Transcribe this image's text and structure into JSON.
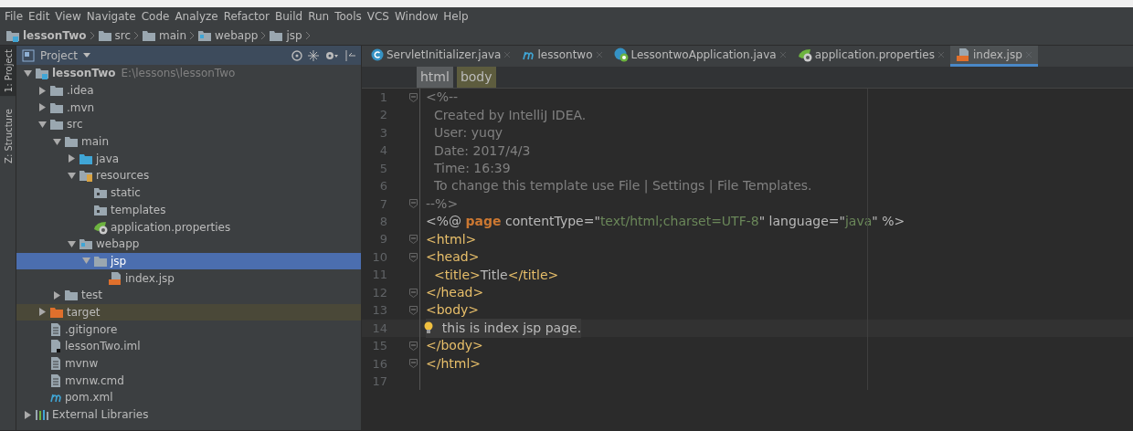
{
  "menu": [
    "File",
    "Edit",
    "View",
    "Navigate",
    "Code",
    "Analyze",
    "Refactor",
    "Build",
    "Run",
    "Tools",
    "VCS",
    "Window",
    "Help"
  ],
  "breadcrumbs": [
    {
      "label": "lessonTwo",
      "kind": "module"
    },
    {
      "label": "src",
      "kind": "folder"
    },
    {
      "label": "main",
      "kind": "folder"
    },
    {
      "label": "webapp",
      "kind": "web"
    },
    {
      "label": "jsp",
      "kind": "folder"
    }
  ],
  "tool_strip": [
    {
      "label": "1: Project",
      "selected": true
    },
    {
      "label": "Z: Structure",
      "selected": false
    }
  ],
  "project_panel": {
    "title": "Project",
    "tree": [
      {
        "label": "lessonTwo",
        "note": "E:\\lessons\\lessonTwo",
        "kind": "module",
        "expanded": true,
        "selected": false,
        "children": [
          {
            "label": ".idea",
            "kind": "folder",
            "expanded": false,
            "selected": false
          },
          {
            "label": ".mvn",
            "kind": "folder",
            "expanded": false,
            "selected": false
          },
          {
            "label": "src",
            "kind": "folder",
            "expanded": true,
            "selected": false,
            "children": [
              {
                "label": "main",
                "kind": "folder",
                "expanded": true,
                "selected": false,
                "children": [
                  {
                    "label": "java",
                    "kind": "source",
                    "expanded": false,
                    "selected": false
                  },
                  {
                    "label": "resources",
                    "kind": "resources",
                    "expanded": true,
                    "selected": false,
                    "children": [
                      {
                        "label": "static",
                        "kind": "plain-folder",
                        "selected": false
                      },
                      {
                        "label": "templates",
                        "kind": "plain-folder",
                        "selected": false
                      },
                      {
                        "label": "application.properties",
                        "kind": "spring-props",
                        "selected": false
                      }
                    ]
                  },
                  {
                    "label": "webapp",
                    "kind": "web",
                    "expanded": true,
                    "selected": false,
                    "children": [
                      {
                        "label": "jsp",
                        "kind": "folder",
                        "expanded": true,
                        "selected": true,
                        "children": [
                          {
                            "label": "index.jsp",
                            "kind": "jsp",
                            "selected": false
                          }
                        ]
                      }
                    ]
                  }
                ]
              },
              {
                "label": "test",
                "kind": "folder",
                "expanded": false,
                "selected": false
              }
            ]
          },
          {
            "label": "target",
            "kind": "excluded",
            "expanded": false,
            "selected": false
          },
          {
            "label": ".gitignore",
            "kind": "file",
            "selected": false
          },
          {
            "label": "lessonTwo.iml",
            "kind": "iml",
            "selected": false
          },
          {
            "label": "mvnw",
            "kind": "file",
            "selected": false
          },
          {
            "label": "mvnw.cmd",
            "kind": "file",
            "selected": false
          },
          {
            "label": "pom.xml",
            "kind": "maven",
            "selected": false
          }
        ]
      },
      {
        "label": "External Libraries",
        "kind": "libraries",
        "expanded": false,
        "selected": false
      }
    ]
  },
  "editor_tabs": [
    {
      "label": "ServletInitializer.java",
      "kind": "class",
      "selected": false
    },
    {
      "label": "lessontwo",
      "kind": "maven",
      "selected": false
    },
    {
      "label": "LessontwoApplication.java",
      "kind": "spring-class",
      "selected": false
    },
    {
      "label": "application.properties",
      "kind": "spring-props",
      "selected": false
    },
    {
      "label": "index.jsp",
      "kind": "jsp",
      "selected": true
    }
  ],
  "tag_path": [
    {
      "label": "html",
      "selected": false
    },
    {
      "label": "body",
      "selected": true
    }
  ],
  "code_lines": [
    {
      "number": "1",
      "fold": true,
      "current": false,
      "bulb": false,
      "tokens": [
        {
          "kind": "comment",
          "text": "<%--"
        }
      ]
    },
    {
      "number": "2",
      "fold": false,
      "current": false,
      "bulb": false,
      "tokens": [
        {
          "kind": "comment",
          "text": "  Created by IntelliJ IDEA."
        }
      ]
    },
    {
      "number": "3",
      "fold": false,
      "current": false,
      "bulb": false,
      "tokens": [
        {
          "kind": "comment",
          "text": "  User: yuqy"
        }
      ]
    },
    {
      "number": "4",
      "fold": false,
      "current": false,
      "bulb": false,
      "tokens": [
        {
          "kind": "comment",
          "text": "  Date: 2017/4/3"
        }
      ]
    },
    {
      "number": "5",
      "fold": false,
      "current": false,
      "bulb": false,
      "tokens": [
        {
          "kind": "comment",
          "text": "  Time: 16:39"
        }
      ]
    },
    {
      "number": "6",
      "fold": false,
      "current": false,
      "bulb": false,
      "tokens": [
        {
          "kind": "comment",
          "text": "  To change this template use File | Settings | File Templates."
        }
      ]
    },
    {
      "number": "7",
      "fold": true,
      "current": false,
      "bulb": false,
      "tokens": [
        {
          "kind": "comment",
          "text": "--%>"
        }
      ]
    },
    {
      "number": "8",
      "fold": false,
      "current": false,
      "bulb": false,
      "tokens": [
        {
          "kind": "plain",
          "text": "<%@ "
        },
        {
          "kind": "keyword",
          "text": "page"
        },
        {
          "kind": "plain",
          "text": " contentType=\""
        },
        {
          "kind": "string",
          "text": "text/html;charset=UTF-8"
        },
        {
          "kind": "plain",
          "text": "\" language=\""
        },
        {
          "kind": "string",
          "text": "java"
        },
        {
          "kind": "plain",
          "text": "\" %>"
        }
      ]
    },
    {
      "number": "9",
      "fold": true,
      "current": false,
      "bulb": false,
      "tokens": [
        {
          "kind": "tag",
          "text": "<html>"
        }
      ]
    },
    {
      "number": "10",
      "fold": true,
      "current": false,
      "bulb": false,
      "tokens": [
        {
          "kind": "tag",
          "text": "<head>"
        }
      ]
    },
    {
      "number": "11",
      "fold": false,
      "current": false,
      "bulb": false,
      "tokens": [
        {
          "kind": "tag",
          "text": "  <title>"
        },
        {
          "kind": "plain",
          "text": "Title"
        },
        {
          "kind": "tag",
          "text": "</title>"
        }
      ]
    },
    {
      "number": "12",
      "fold": true,
      "current": false,
      "bulb": false,
      "tokens": [
        {
          "kind": "tag",
          "text": "</head>"
        }
      ]
    },
    {
      "number": "13",
      "fold": true,
      "current": false,
      "bulb": false,
      "tokens": [
        {
          "kind": "tag",
          "text": "<body>"
        }
      ]
    },
    {
      "number": "14",
      "fold": false,
      "current": true,
      "bulb": true,
      "tokens": [
        {
          "kind": "plain",
          "text": "    this is index jsp page."
        }
      ]
    },
    {
      "number": "15",
      "fold": true,
      "current": false,
      "bulb": false,
      "tokens": [
        {
          "kind": "tag",
          "text": "</body>"
        }
      ]
    },
    {
      "number": "16",
      "fold": true,
      "current": false,
      "bulb": false,
      "tokens": [
        {
          "kind": "tag",
          "text": "</html>"
        }
      ]
    },
    {
      "number": "17",
      "fold": false,
      "current": false,
      "bulb": false
    }
  ]
}
